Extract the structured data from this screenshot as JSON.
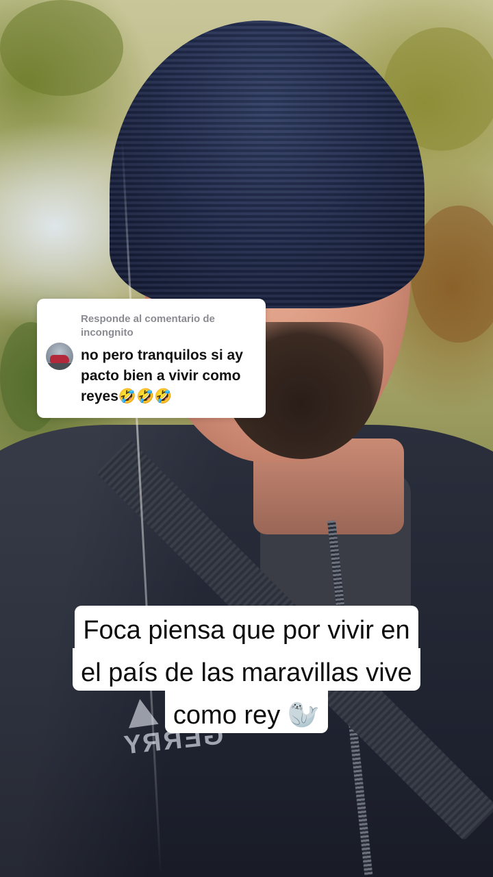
{
  "reply_card": {
    "header": "Responde al comentario de incongnito",
    "comment": "no pero tranquilos si ay pacto bien a vivir como reyes🤣🤣🤣"
  },
  "caption": {
    "line1": "Foca piensa que por vivir en",
    "line2": "el país de las maravillas vive",
    "line3": "como rey 🦭"
  },
  "jacket_brand": "GERRY"
}
